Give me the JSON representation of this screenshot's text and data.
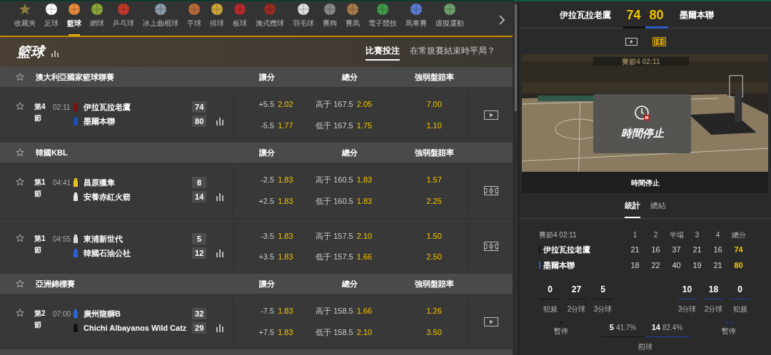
{
  "sports_nav": [
    {
      "kind": "favorites",
      "label": "收藏夾",
      "selected": false
    },
    {
      "kind": "sport",
      "label": "足球",
      "selected": false
    },
    {
      "kind": "sport",
      "label": "籃球",
      "selected": true
    },
    {
      "kind": "sport",
      "label": "網球",
      "selected": false
    },
    {
      "kind": "sport",
      "label": "乒乓球",
      "selected": false
    },
    {
      "kind": "sport",
      "label": "冰上曲棍球",
      "selected": false
    },
    {
      "kind": "sport",
      "label": "手球",
      "selected": false
    },
    {
      "kind": "sport",
      "label": "排球",
      "selected": false
    },
    {
      "kind": "sport",
      "label": "板球",
      "selected": false
    },
    {
      "kind": "sport",
      "label": "澳式欖球",
      "selected": false
    },
    {
      "kind": "sport",
      "label": "羽毛球",
      "selected": false
    },
    {
      "kind": "sport",
      "label": "賽狗",
      "selected": false
    },
    {
      "kind": "sport",
      "label": "賽馬",
      "selected": false
    },
    {
      "kind": "sport",
      "label": "電子競技",
      "selected": false
    },
    {
      "kind": "sport",
      "label": "馬車賽",
      "selected": false
    },
    {
      "kind": "sport",
      "label": "虛擬運動",
      "selected": false
    }
  ],
  "page": {
    "title": "籃球",
    "tabs": [
      {
        "label": "比賽投注",
        "selected": true
      },
      {
        "label": "在常規賽結束時平局？",
        "selected": false
      }
    ]
  },
  "leagues": [
    {
      "name": "澳大利亞國家籃球聯賽",
      "columns": [
        "讓分",
        "總分",
        "強弱盤賠率"
      ],
      "matches": [
        {
          "period": "第4節",
          "time": "02:11",
          "kind": "video",
          "teams": [
            {
              "name": "伊拉瓦拉老鷹",
              "color": "#7a1010",
              "score": "74"
            },
            {
              "name": "墨爾本聯",
              "color": "#1e4fbf",
              "score": "80"
            }
          ],
          "lines": [
            {
              "spread": "+5.5",
              "spread_odds": "2.02",
              "total": "高于 167.5",
              "total_odds": "2.05",
              "moneyline": "7.00"
            },
            {
              "spread": "-5.5",
              "spread_odds": "1.77",
              "total": "低于 167.5",
              "total_odds": "1.75",
              "moneyline": "1.10"
            }
          ]
        }
      ]
    },
    {
      "name": "韓國KBL",
      "columns": [
        "讓分",
        "總分",
        "強弱盤賠率"
      ],
      "matches": [
        {
          "period": "第1節",
          "time": "04:41",
          "kind": "court",
          "teams": [
            {
              "name": "昌原獵隼",
              "color": "#e8c21a",
              "score": "8"
            },
            {
              "name": "安養赤紅火箭",
              "color": "#e6e6e6",
              "score": "14"
            }
          ],
          "lines": [
            {
              "spread": "-2.5",
              "spread_odds": "1.83",
              "total": "高于 160.5",
              "total_odds": "1.83",
              "moneyline": "1.57"
            },
            {
              "spread": "+2.5",
              "spread_odds": "1.83",
              "total": "低于 160.5",
              "total_odds": "1.83",
              "moneyline": "2.25"
            }
          ]
        },
        {
          "period": "第1節",
          "time": "04:55",
          "kind": "court",
          "teams": [
            {
              "name": "東浦新世代",
              "color": "#d8d8d8",
              "score": "5"
            },
            {
              "name": "韓國石油公社",
              "color": "#2c62d6",
              "score": "12"
            }
          ],
          "lines": [
            {
              "spread": "-3.5",
              "spread_odds": "1.83",
              "total": "高于 157.5",
              "total_odds": "2.10",
              "moneyline": "1.50"
            },
            {
              "spread": "+3.5",
              "spread_odds": "1.83",
              "total": "低于 157.5",
              "total_odds": "1.66",
              "moneyline": "2.50"
            }
          ]
        }
      ]
    },
    {
      "name": "亞洲錦標賽",
      "columns": [
        "讓分",
        "總分",
        "強弱盤賠率"
      ],
      "matches": [
        {
          "period": "第2節",
          "time": "07:00",
          "kind": "video",
          "teams": [
            {
              "name": "廣州龍獅B",
              "color": "#2c62d6",
              "score": "32"
            },
            {
              "name": "Chichi Albayanos Wild Catz",
              "color": "#111111",
              "score": "29"
            }
          ],
          "lines": [
            {
              "spread": "-7.5",
              "spread_odds": "1.83",
              "total": "高于 158.5",
              "total_odds": "1.66",
              "moneyline": "1.26"
            },
            {
              "spread": "+7.5",
              "spread_odds": "1.83",
              "total": "低于 158.5",
              "total_odds": "2.10",
              "moneyline": "3.50"
            }
          ]
        }
      ]
    }
  ],
  "live": {
    "teams": [
      {
        "name": "伊拉瓦拉老鷹",
        "score": "74",
        "color": "#111111"
      },
      {
        "name": "墨爾本聯",
        "score": "80",
        "color": "#2c5cc5"
      }
    ],
    "media_tabs": [
      {
        "kind": "video",
        "selected": false
      },
      {
        "kind": "court",
        "selected": true
      }
    ],
    "clock_label": "賽節4 02:11",
    "overlay": "時間停止",
    "status": "時間停止",
    "tabs": [
      {
        "label": "統計",
        "selected": true
      },
      {
        "label": "總結",
        "selected": false
      }
    ],
    "table": {
      "columns": [
        "賽節4 02:11",
        "1",
        "2",
        "半場",
        "3",
        "4",
        "總分"
      ],
      "rows": [
        {
          "team": "伊拉瓦拉老鷹",
          "color": "#111111",
          "values": [
            "21",
            "16",
            "37",
            "21",
            "16",
            "74"
          ]
        },
        {
          "team": "墨爾本聯",
          "color": "#2c5cc5",
          "values": [
            "18",
            "22",
            "40",
            "19",
            "21",
            "80"
          ]
        }
      ]
    },
    "counters": [
      [
        {
          "value": "0",
          "label": "犯規"
        },
        {
          "value": "27",
          "label": "2分球"
        },
        {
          "value": "5",
          "label": "3分球"
        }
      ],
      [
        {
          "value": "10",
          "label": "3分球"
        },
        {
          "value": "18",
          "label": "2分球"
        },
        {
          "value": "0",
          "label": "犯規"
        }
      ]
    ],
    "timeouts": [
      {
        "label": "暫停",
        "dots": [
          {
            "color": "#111111"
          }
        ]
      },
      {
        "label": "暫停",
        "dots": [
          {
            "color": "#1f3fa0"
          },
          {
            "color": "#1f3fa0"
          }
        ]
      }
    ],
    "free_throws": {
      "label": "罰球",
      "sides": [
        {
          "made": "5",
          "pct": "41.7%"
        },
        {
          "made": "14",
          "pct": "82.4%"
        }
      ]
    }
  }
}
